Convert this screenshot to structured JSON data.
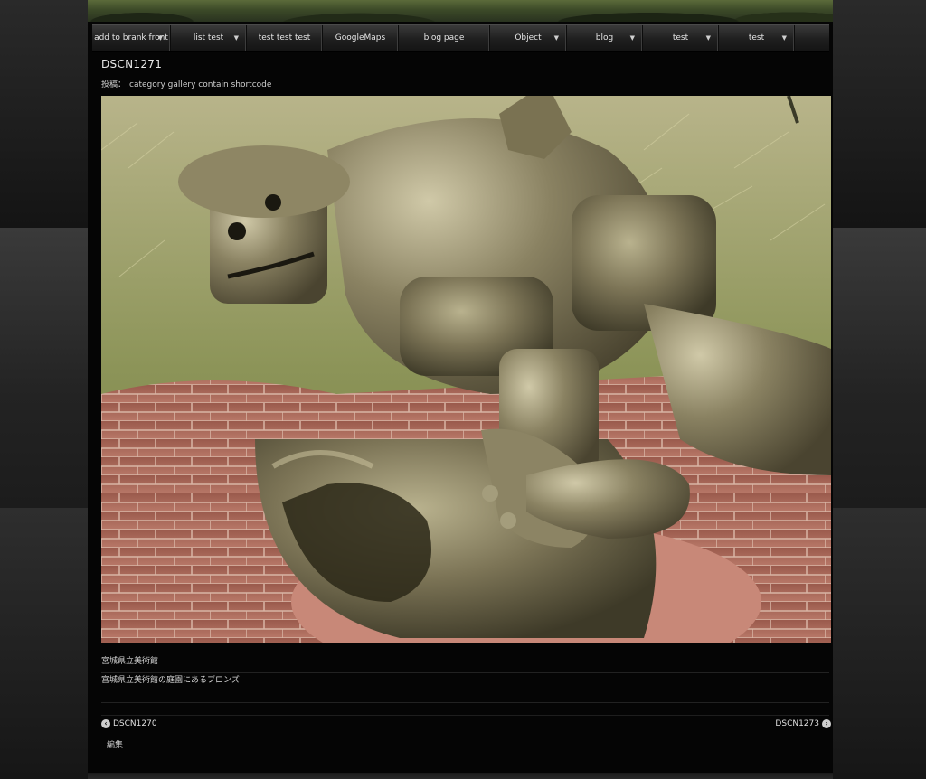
{
  "nav": {
    "items": [
      {
        "label": "add to brank front",
        "has_arrow": true
      },
      {
        "label": "list test",
        "has_arrow": true
      },
      {
        "label": "test test test",
        "has_arrow": false
      },
      {
        "label": "GoogleMaps",
        "has_arrow": false
      },
      {
        "label": "blog page",
        "has_arrow": false
      },
      {
        "label": "Object",
        "has_arrow": true
      },
      {
        "label": "blog",
        "has_arrow": true
      },
      {
        "label": "test",
        "has_arrow": true
      },
      {
        "label": "test",
        "has_arrow": true
      }
    ]
  },
  "post": {
    "title": "DSCN1271",
    "meta_prefix": "投稿：",
    "meta_category": "category gallery contain shortcode",
    "image_icon": "bronze-robot-sculpture-photo",
    "caption": "宮城県立美術館",
    "description": "宮城県立美術館の庭園にあるブロンズ"
  },
  "pager": {
    "prev_label": "DSCN1270",
    "next_label": "DSCN1273",
    "prev_icon": "chevron-left-circle-icon",
    "next_icon": "chevron-right-circle-icon"
  },
  "edit_label": "編集"
}
